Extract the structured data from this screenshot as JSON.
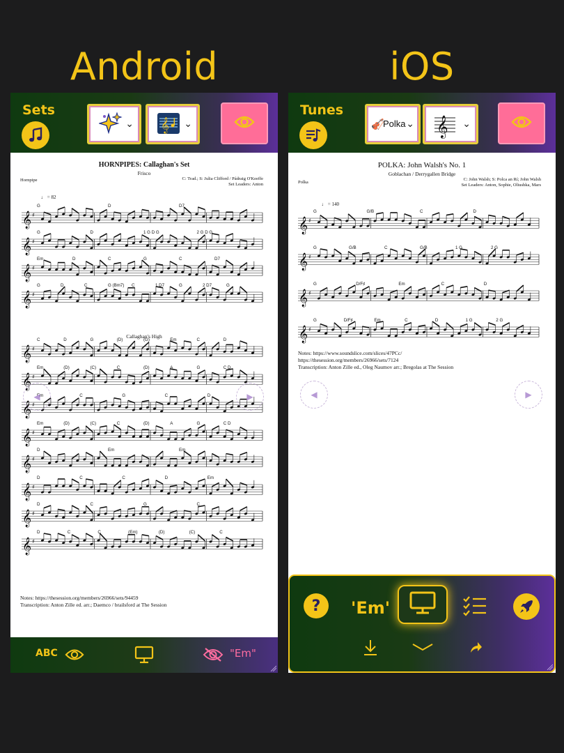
{
  "labels": {
    "android": "Android",
    "ios": "iOS"
  },
  "colors": {
    "accent": "#f3c418",
    "pink": "#ff6d98",
    "green": "#0f3a10",
    "purple": "#5c2f9a"
  },
  "android": {
    "topbar": {
      "title": "Sets",
      "title_icon": "music-note-icon",
      "dropdown1_icon": "sparkles-icon",
      "dropdown2_icon": "music-sheet-icon",
      "toggle_icon": "eye-icon"
    },
    "sheet": {
      "title": "HORNPIPES: Callaghan's Set",
      "subtitle": "Frisco",
      "rhythm": "Hornpipe",
      "composer": "C: Trad.; S: Julia Clifford / Pádraig O'Keeffe",
      "leaders": "Set Leaders: Anton",
      "tempo": "♩ = 82",
      "second_tune": "Callaghan's High",
      "chords": [
        [
          "G",
          "D",
          "D7"
        ],
        [
          "G",
          "D",
          "1 G D G",
          "2 G D G"
        ],
        [
          "Em",
          "D",
          "C",
          "G",
          "C",
          "D7"
        ],
        [
          "G",
          "D",
          "C",
          "G (Bm7)",
          "C",
          "1 D7",
          "G",
          "2 D7",
          "G"
        ],
        [
          "C",
          "D",
          "G",
          "(D)",
          "(G)",
          "Em",
          "C",
          "D"
        ],
        [
          "Em",
          "(D)",
          "(C)",
          "C",
          "(D)",
          "A",
          "G",
          "C D"
        ],
        [
          "Em",
          "C",
          "G",
          "C",
          "D"
        ],
        [
          "Em",
          "(D)",
          "(C)",
          "C",
          "(D)",
          "A",
          "G",
          "C D"
        ],
        [
          "D",
          "Em",
          "Em"
        ],
        [
          "D",
          "C",
          "C",
          "D",
          "Em"
        ],
        [
          "D",
          "C",
          "G",
          "C"
        ],
        [
          "D",
          "C",
          "C",
          "(Em)",
          "(D)",
          "(C)",
          "C"
        ]
      ],
      "notes_line1": "Notes: https://thesession.org/members/26966/sets/94459",
      "notes_line2": "Transcription: Anton Zille ed. arr.; Daemco / brailsford at The Session"
    },
    "bottom": {
      "abc": "ABC",
      "eye_icon": "eye-icon",
      "screen_icon": "monitor-icon",
      "hidden_icon": "eye-off-icon",
      "key": "\"Em\""
    }
  },
  "ios": {
    "topbar": {
      "title": "Tunes",
      "title_icon": "playlist-icon",
      "dropdown1_label": "Polka",
      "dropdown1_icon": "violin-icon",
      "dropdown2_icon": "treble-clef-icon",
      "toggle_icon": "eye-icon"
    },
    "sheet": {
      "title": "POLKA: John Walsh's No. 1",
      "subtitle": "Goblachan / Derrygallen Bridge",
      "rhythm": "Polka",
      "composer": "C: John Walsh; S: Polca an Rí; John Walsh",
      "leaders": "Set Leaders: Anton, Sophie, Oliushka, Mars",
      "tempo": "♩ = 140",
      "chords": [
        [
          "G",
          "G/B",
          "C",
          "D"
        ],
        [
          "G",
          "G/B",
          "C",
          "G/B",
          "1 G",
          "2 G"
        ],
        [
          "G",
          "D/F♯",
          "Em",
          "C",
          "D"
        ],
        [
          "G",
          "D/F♯",
          "Em",
          "C",
          "D",
          "1 G",
          "2 G"
        ]
      ],
      "notes_line1": "Notes: https://www.soundslice.com/slices/47PCc/",
      "notes_line2": "https://thesession.org/members/26966/sets/7124",
      "notes_line3": "Transcription: Anton Zille ed., Oleg Naumov arr.; Bregolas at The Session"
    },
    "panel": {
      "help_icon": "question-icon",
      "key": "'Em'",
      "screen_icon": "monitor-icon",
      "list_icon": "checklist-icon",
      "rocket_icon": "rocket-icon",
      "download_icon": "download-icon",
      "chevron_icon": "chevron-down-icon",
      "share_icon": "share-icon"
    }
  }
}
